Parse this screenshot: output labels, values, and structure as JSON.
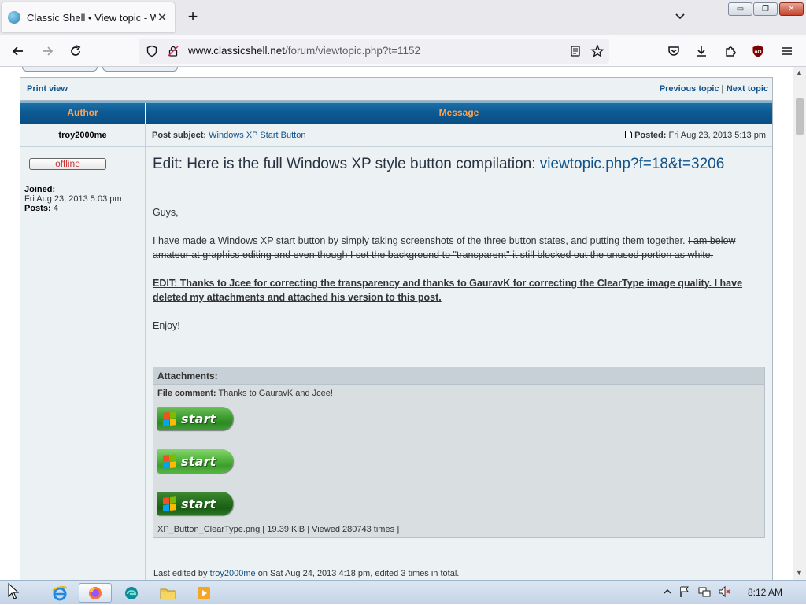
{
  "browser": {
    "tab_title": "Classic Shell • View topic - Windows XP Start Button",
    "url_domain": "www.classicshell.net",
    "url_path": "/forum/viewtopic.php?t=1152"
  },
  "window_controls": {
    "minimize": "▭",
    "maximize": "❐",
    "close": "✕"
  },
  "nav": {
    "print_view": "Print view",
    "previous_topic": "Previous topic",
    "separator": "|",
    "next_topic": "Next topic"
  },
  "table": {
    "col_author": "Author",
    "col_message": "Message"
  },
  "post": {
    "author": "troy2000me",
    "subject_label": "Post subject:",
    "subject_value": "Windows XP Start Button",
    "posted_label": "Posted:",
    "posted_value": "Fri Aug 23, 2013 5:13 pm",
    "status": "offline",
    "joined_label": "Joined:",
    "joined_value": "Fri Aug 23, 2013 5:03 pm",
    "posts_label": "Posts:",
    "posts_value": "4",
    "title_text": "Edit: Here is the full Windows XP style button compilation: ",
    "title_link": "viewtopic.php?f=18&t=3206",
    "greeting": "Guys,",
    "body_text": "I have made a Windows XP start button by simply taking screenshots of the three button states, and putting them together. ",
    "body_strike": "I am below amateur at graphics editing and even though I set the background to \"transparent\" it still blocked out the unused portion as white.",
    "edit_note": "EDIT: Thanks to Jcee for correcting the transparency and thanks to GauravK for correcting the ClearType image quality. I have deleted my attachments and attached his version to this post.",
    "closing": "Enjoy!",
    "attachments_label": "Attachments:",
    "file_comment_label": "File comment:",
    "file_comment_value": "Thanks to GauravK and Jcee!",
    "start_label": "start",
    "file_name": "XP_Button_ClearType.png",
    "file_meta": " [ 19.39 KiB | Viewed 280743 times ]",
    "last_edited_prefix": "Last edited by ",
    "last_edited_user": "troy2000me",
    "last_edited_suffix": " on Sat Aug 24, 2013 4:18 pm, edited 3 times in total."
  },
  "taskbar": {
    "clock": "8:12 AM"
  },
  "colors": {
    "header_blue": "#0b5a94",
    "header_text": "#ffa34f",
    "link": "#105289",
    "row_bg": "#ecf1f3",
    "offline_red": "#cc3333"
  }
}
